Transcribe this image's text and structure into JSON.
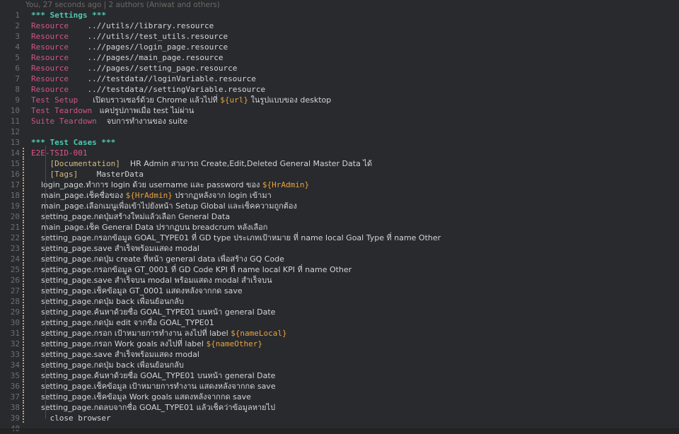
{
  "editor": {
    "background": "#282a2e",
    "foreground": "#d4d4d4",
    "total_lines": 40
  },
  "blame": {
    "text": "You, 27 seconds ago | 2 authors (Aniwat and others)",
    "color": "#6f6a62"
  },
  "colors": {
    "section_header": "#4ec9b0",
    "setting_keyword": "#d1558a",
    "test_case_name": "#e0558a",
    "meta_tag": "#d7ba7d",
    "variable": "#e8a33d",
    "plain_text": "#d4d4d4",
    "line_number": "#6b6f72",
    "indent_guide": "#4a4d50",
    "modified_marker": "#c9a37a"
  },
  "lines": [
    {
      "n": 1,
      "modified": false,
      "segments": [
        {
          "cls": "t-section",
          "text": "*** Settings ***"
        }
      ]
    },
    {
      "n": 2,
      "modified": false,
      "segments": [
        {
          "cls": "t-setting",
          "text": "Resource"
        },
        {
          "cls": "t-path",
          "text": "    ..//utils//library.resource"
        }
      ]
    },
    {
      "n": 3,
      "modified": false,
      "segments": [
        {
          "cls": "t-setting",
          "text": "Resource"
        },
        {
          "cls": "t-path",
          "text": "    ..//utils//test_utils.resource"
        }
      ]
    },
    {
      "n": 4,
      "modified": false,
      "segments": [
        {
          "cls": "t-setting",
          "text": "Resource"
        },
        {
          "cls": "t-path",
          "text": "    ..//pages//login_page.resource"
        }
      ]
    },
    {
      "n": 5,
      "modified": false,
      "segments": [
        {
          "cls": "t-setting",
          "text": "Resource"
        },
        {
          "cls": "t-path",
          "text": "    ..//pages//main_page.resource"
        }
      ]
    },
    {
      "n": 6,
      "modified": false,
      "segments": [
        {
          "cls": "t-setting",
          "text": "Resource"
        },
        {
          "cls": "t-path",
          "text": "    ..//pages//setting_page.resource"
        }
      ]
    },
    {
      "n": 7,
      "modified": false,
      "segments": [
        {
          "cls": "t-setting",
          "text": "Resource"
        },
        {
          "cls": "t-path",
          "text": "    ..//testdata//loginVariable.resource"
        }
      ]
    },
    {
      "n": 8,
      "modified": false,
      "segments": [
        {
          "cls": "t-setting",
          "text": "Resource"
        },
        {
          "cls": "t-path",
          "text": "    ..//testdata//settingVariable.resource"
        }
      ]
    },
    {
      "n": 9,
      "modified": false,
      "segments": [
        {
          "cls": "t-setting",
          "text": "Test Setup"
        },
        {
          "cls": "t-plain thai",
          "text": "      เปิดบราวเซอร์ด้วย Chrome แล้วไปที่ "
        },
        {
          "cls": "t-var",
          "text": "${url}"
        },
        {
          "cls": "t-plain thai",
          "text": " ในรูปแบบของ desktop"
        }
      ]
    },
    {
      "n": 10,
      "modified": false,
      "segments": [
        {
          "cls": "t-setting",
          "text": "Test Teardown"
        },
        {
          "cls": "t-plain thai",
          "text": "   แคปรูปภาพเมื่อ test ไม่ผ่าน"
        }
      ]
    },
    {
      "n": 11,
      "modified": false,
      "segments": [
        {
          "cls": "t-setting",
          "text": "Suite Teardown"
        },
        {
          "cls": "t-plain thai",
          "text": "    จบการทำงานของ suite"
        }
      ]
    },
    {
      "n": 12,
      "modified": false,
      "segments": [
        {
          "cls": "t-plain",
          "text": ""
        }
      ]
    },
    {
      "n": 13,
      "modified": false,
      "segments": [
        {
          "cls": "t-section",
          "text": "*** Test Cases ***"
        }
      ]
    },
    {
      "n": 14,
      "modified": true,
      "segments": [
        {
          "cls": "t-testname",
          "text": "E2E-TSID-001"
        }
      ]
    },
    {
      "n": 15,
      "modified": true,
      "segments": [
        {
          "cls": "t-meta",
          "text": "    [Documentation]"
        },
        {
          "cls": "t-plain thai",
          "text": "    HR Admin สามารถ Create,Edit,Deleted General Master Data ได้"
        }
      ]
    },
    {
      "n": 16,
      "modified": true,
      "segments": [
        {
          "cls": "t-meta",
          "text": "    [Tags]"
        },
        {
          "cls": "t-plain",
          "text": "    MasterData"
        }
      ]
    },
    {
      "n": 17,
      "modified": true,
      "segments": [
        {
          "cls": "t-plain thai",
          "text": "    login_page.ทำการ login ด้วย username และ password ของ "
        },
        {
          "cls": "t-var",
          "text": "${HrAdmin}"
        }
      ]
    },
    {
      "n": 18,
      "modified": true,
      "segments": [
        {
          "cls": "t-plain thai",
          "text": "    main_page.เช็คชื่อของ "
        },
        {
          "cls": "t-var",
          "text": "${HrAdmin}"
        },
        {
          "cls": "t-plain thai",
          "text": " ปรากฏหลังจาก login เข้ามา"
        }
      ]
    },
    {
      "n": 19,
      "modified": true,
      "segments": [
        {
          "cls": "t-plain thai",
          "text": "    main_page.เลือกเมนูเพื่อเข้าไปยังหน้า Setup Global และเช็คความถูกต้อง"
        }
      ]
    },
    {
      "n": 20,
      "modified": true,
      "segments": [
        {
          "cls": "t-plain thai",
          "text": "    setting_page.กดปุ่มสร้างใหม่แล้วเลือก General Data"
        }
      ]
    },
    {
      "n": 21,
      "modified": true,
      "segments": [
        {
          "cls": "t-plain thai",
          "text": "    main_page.เช็ค General Data ปรากฏบน breadcrum หลังเลือก"
        }
      ]
    },
    {
      "n": 22,
      "modified": true,
      "segments": [
        {
          "cls": "t-plain thai",
          "text": "    setting_page.กรอกข้อมูล GOAL_TYPE01 ที่ GD type ประเภทเป้าหมาย ที่ name local Goal Type ที่ name Other"
        }
      ]
    },
    {
      "n": 23,
      "modified": true,
      "segments": [
        {
          "cls": "t-plain thai",
          "text": "    setting_page.save สำเร็จพร้อมแสดง modal"
        }
      ]
    },
    {
      "n": 24,
      "modified": true,
      "segments": [
        {
          "cls": "t-plain thai",
          "text": "    setting_page.กดปุ่ม create ที่หน้า general data เพื่อสร้าง GQ Code"
        }
      ]
    },
    {
      "n": 25,
      "modified": true,
      "segments": [
        {
          "cls": "t-plain thai",
          "text": "    setting_page.กรอกข้อมูล GT_0001 ที่ GD Code KPI ที่ name local KPI ที่ name Other"
        }
      ]
    },
    {
      "n": 26,
      "modified": true,
      "segments": [
        {
          "cls": "t-plain thai",
          "text": "    setting_page.save สำเร็จบน modal พร้อมแสดง modal สำเร็จบน"
        }
      ]
    },
    {
      "n": 27,
      "modified": true,
      "segments": [
        {
          "cls": "t-plain thai",
          "text": "    setting_page.เช็คข้อมูล GT_0001 แสดงหลังจากกด save"
        }
      ]
    },
    {
      "n": 28,
      "modified": true,
      "segments": [
        {
          "cls": "t-plain thai",
          "text": "    setting_page.กดปุ่ม back เพื่อนย้อนกลับ"
        }
      ]
    },
    {
      "n": 29,
      "modified": true,
      "segments": [
        {
          "cls": "t-plain thai",
          "text": "    setting_page.ค้นหาด้วยชื่อ GOAL_TYPE01 บนหน้า general Date"
        }
      ]
    },
    {
      "n": 30,
      "modified": true,
      "segments": [
        {
          "cls": "t-plain thai",
          "text": "    setting_page.กดปุ่ม edit จากชื่อ GOAL_TYPE01"
        }
      ]
    },
    {
      "n": 31,
      "modified": true,
      "segments": [
        {
          "cls": "t-plain thai",
          "text": "    setting_page.กรอก เป้าหมายการทำงาน ลงไปที่ label "
        },
        {
          "cls": "t-var",
          "text": "${nameLocal}"
        }
      ]
    },
    {
      "n": 32,
      "modified": true,
      "segments": [
        {
          "cls": "t-plain thai",
          "text": "    setting_page.กรอก Work goals ลงไปที่ label "
        },
        {
          "cls": "t-var",
          "text": "${nameOther}"
        }
      ]
    },
    {
      "n": 33,
      "modified": true,
      "segments": [
        {
          "cls": "t-plain thai",
          "text": "    setting_page.save สำเร็จพร้อมแสดง modal"
        }
      ]
    },
    {
      "n": 34,
      "modified": true,
      "segments": [
        {
          "cls": "t-plain thai",
          "text": "    setting_page.กดปุ่ม back เพื่อนย้อนกลับ"
        }
      ]
    },
    {
      "n": 35,
      "modified": true,
      "segments": [
        {
          "cls": "t-plain thai",
          "text": "    setting_page.ค้นหาด้วยชื่อ GOAL_TYPE01 บนหน้า general Date"
        }
      ]
    },
    {
      "n": 36,
      "modified": true,
      "segments": [
        {
          "cls": "t-plain thai",
          "text": "    setting_page.เช็คข้อมูล เป้าหมายการทำงาน แสดงหลังจากกด save"
        }
      ]
    },
    {
      "n": 37,
      "modified": true,
      "segments": [
        {
          "cls": "t-plain thai",
          "text": "    setting_page.เช็คข้อมูล Work goals แสดงหลังจากกด save"
        }
      ]
    },
    {
      "n": 38,
      "modified": true,
      "segments": [
        {
          "cls": "t-plain thai",
          "text": "    setting_page.กดลบจากชื่อ GOAL_TYPE01 แล้วเช็คว่าข้อมูลหายไป"
        }
      ]
    },
    {
      "n": 39,
      "modified": true,
      "segments": [
        {
          "cls": "t-plain",
          "text": "    close browser"
        }
      ]
    },
    {
      "n": 40,
      "modified": false,
      "segments": [
        {
          "cls": "t-plain",
          "text": ""
        }
      ]
    }
  ]
}
